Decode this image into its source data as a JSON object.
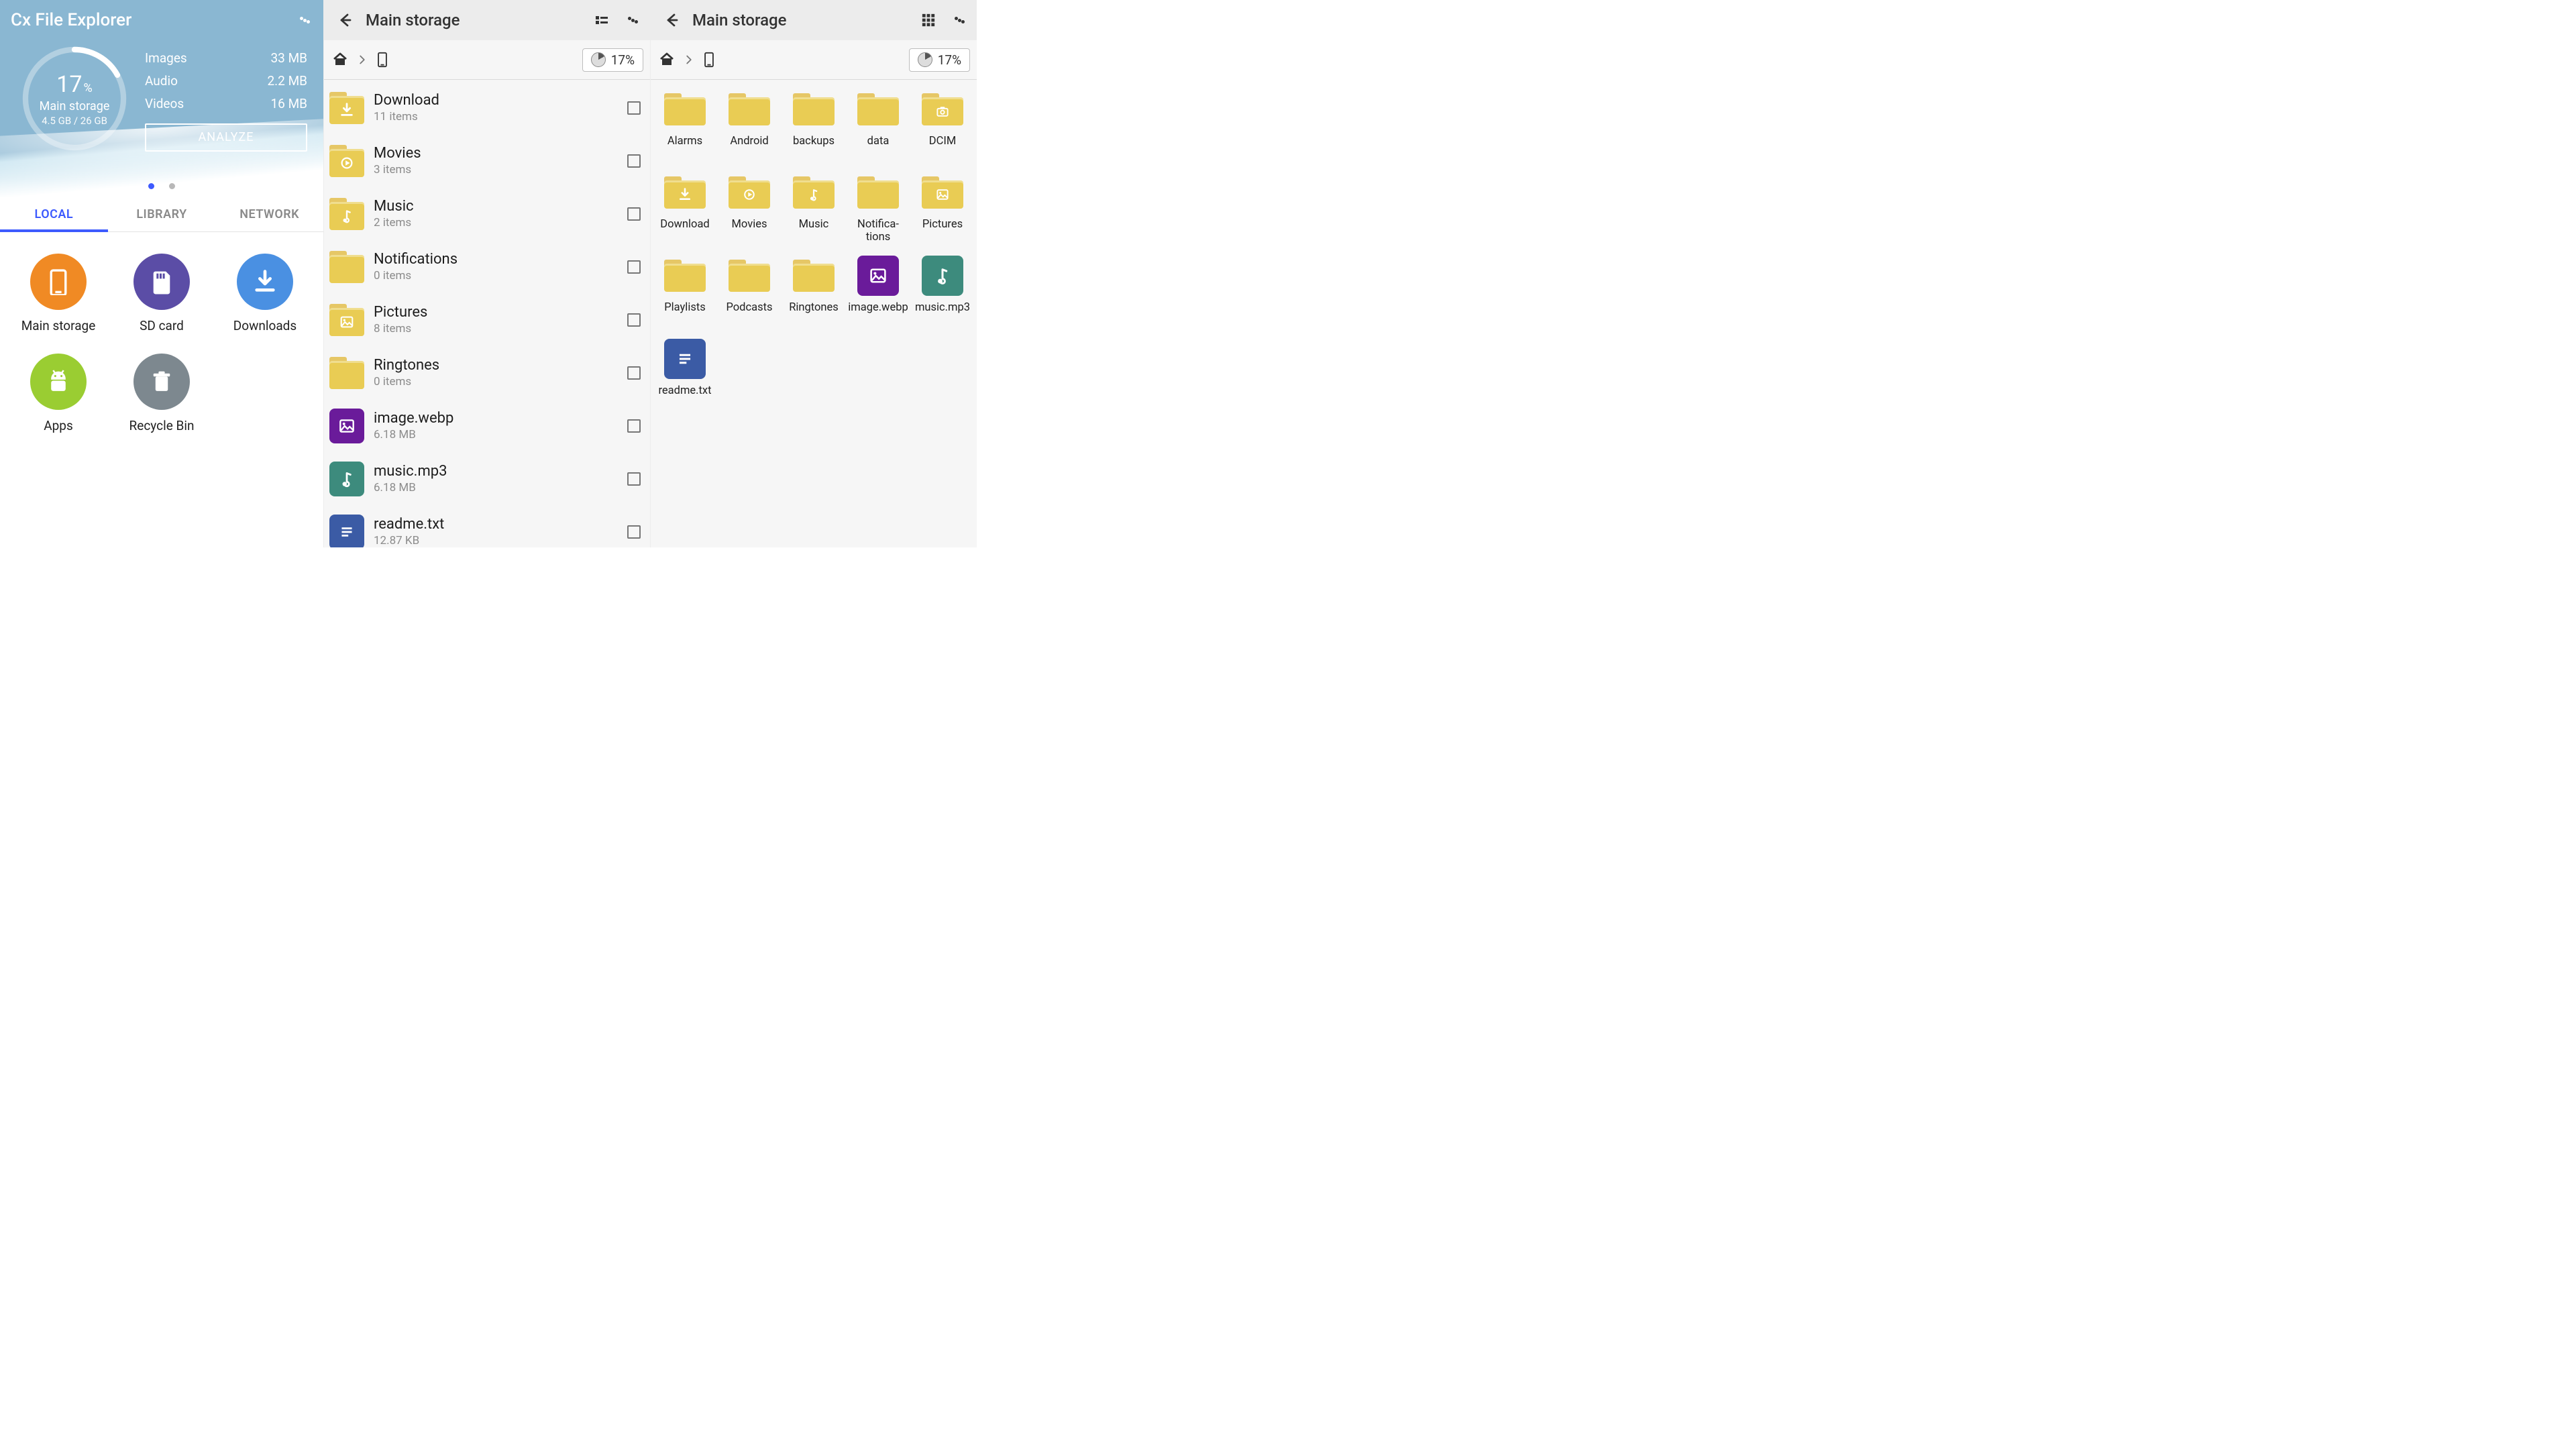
{
  "pane1": {
    "title": "Cx File Explorer",
    "ring": {
      "percent": "17",
      "percent_unit": "%",
      "label": "Main storage",
      "sub": "4.5 GB / 26 GB"
    },
    "stats": [
      {
        "label": "Images",
        "value": "33 MB"
      },
      {
        "label": "Audio",
        "value": "2.2 MB"
      },
      {
        "label": "Videos",
        "value": "16 MB"
      }
    ],
    "analyze": "ANALYZE",
    "tabs": [
      "LOCAL",
      "LIBRARY",
      "NETWORK"
    ],
    "shortcuts": [
      {
        "label": "Main storage",
        "icon": "phone",
        "color": "c-orange"
      },
      {
        "label": "SD card",
        "icon": "sd",
        "color": "c-purple"
      },
      {
        "label": "Downloads",
        "icon": "download",
        "color": "c-blue"
      },
      {
        "label": "Apps",
        "icon": "android",
        "color": "c-green"
      },
      {
        "label": "Recycle Bin",
        "icon": "trash",
        "color": "c-grey"
      }
    ]
  },
  "pane2": {
    "title": "Main storage",
    "percent": "17%",
    "items": [
      {
        "name": "Download",
        "sub": "11 items",
        "type": "folder",
        "glyph": "download"
      },
      {
        "name": "Movies",
        "sub": "3 items",
        "type": "folder",
        "glyph": "play"
      },
      {
        "name": "Music",
        "sub": "2 items",
        "type": "folder",
        "glyph": "note"
      },
      {
        "name": "Notifications",
        "sub": "0 items",
        "type": "folder",
        "glyph": ""
      },
      {
        "name": "Pictures",
        "sub": "8 items",
        "type": "folder",
        "glyph": "image"
      },
      {
        "name": "Ringtones",
        "sub": "0 items",
        "type": "folder",
        "glyph": ""
      },
      {
        "name": "image.webp",
        "sub": "6.18 MB",
        "type": "file",
        "fileColor": "sq-purple",
        "glyph": "image"
      },
      {
        "name": "music.mp3",
        "sub": "6.18 MB",
        "type": "file",
        "fileColor": "sq-teal",
        "glyph": "note"
      },
      {
        "name": "readme.txt",
        "sub": "12.87 KB",
        "type": "file",
        "fileColor": "sq-navy",
        "glyph": "text"
      }
    ]
  },
  "pane3": {
    "title": "Main storage",
    "percent": "17%",
    "items": [
      {
        "label": "Alarms",
        "type": "folder",
        "glyph": ""
      },
      {
        "label": "Android",
        "type": "folder",
        "glyph": ""
      },
      {
        "label": "backups",
        "type": "folder",
        "glyph": ""
      },
      {
        "label": "data",
        "type": "folder",
        "glyph": ""
      },
      {
        "label": "DCIM",
        "type": "folder",
        "glyph": "camera"
      },
      {
        "label": "Download",
        "type": "folder",
        "glyph": "download"
      },
      {
        "label": "Movies",
        "type": "folder",
        "glyph": "play"
      },
      {
        "label": "Music",
        "type": "folder",
        "glyph": "note"
      },
      {
        "label": "Notifica­tions",
        "type": "folder",
        "glyph": ""
      },
      {
        "label": "Pictures",
        "type": "folder",
        "glyph": "image"
      },
      {
        "label": "Playlists",
        "type": "folder",
        "glyph": ""
      },
      {
        "label": "Podcasts",
        "type": "folder",
        "glyph": ""
      },
      {
        "label": "Ringtones",
        "type": "folder",
        "glyph": ""
      },
      {
        "label": "image.webp",
        "type": "file",
        "fileColor": "sq-purple",
        "glyph": "image"
      },
      {
        "label": "music.mp3",
        "type": "file",
        "fileColor": "sq-teal",
        "glyph": "note"
      },
      {
        "label": "readme.txt",
        "type": "file",
        "fileColor": "sq-navy",
        "glyph": "text"
      }
    ]
  }
}
